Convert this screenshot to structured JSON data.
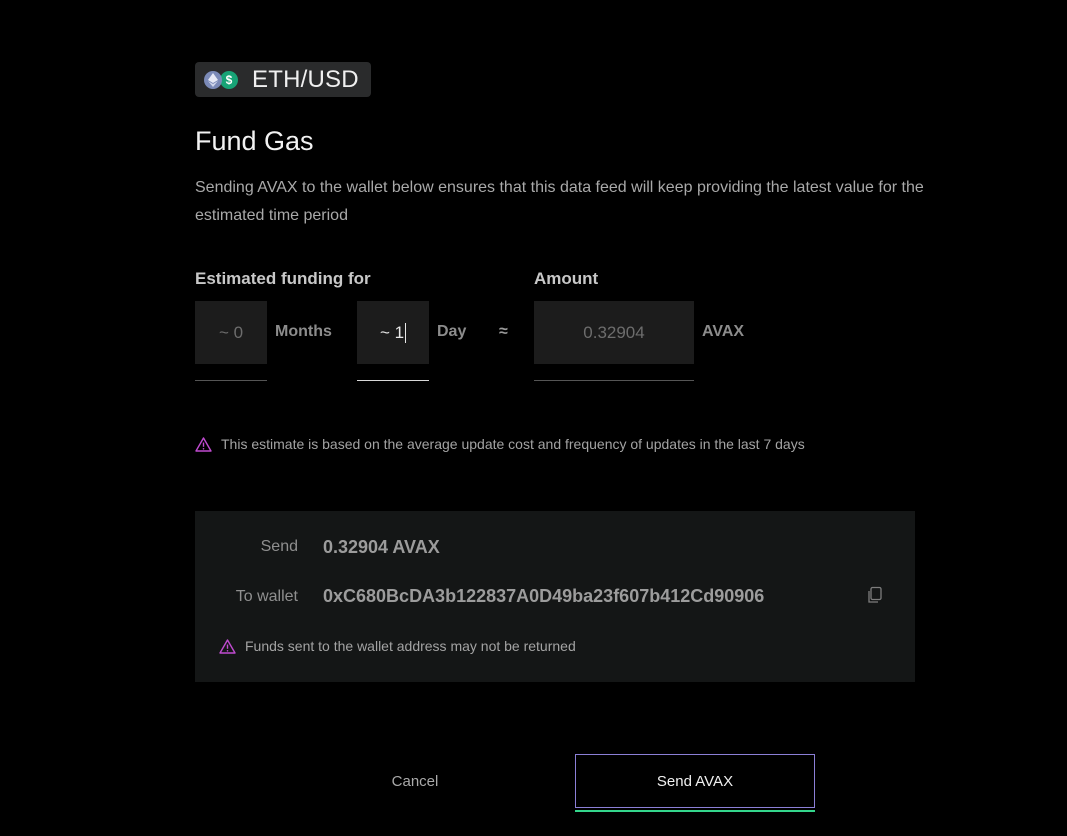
{
  "pair": {
    "label": "ETH/USD",
    "icons": [
      "eth-icon",
      "usd-icon"
    ]
  },
  "title": "Fund Gas",
  "description": "Sending AVAX to the wallet below ensures that this data feed will keep providing the latest value for the estimated time period",
  "funding": {
    "label": "Estimated funding for",
    "months_value": "~ 0",
    "months_unit": "Months",
    "days_value": "~ 1",
    "days_unit": "Day",
    "approx": "≈"
  },
  "amount": {
    "label": "Amount",
    "value": "0.32904",
    "unit": "AVAX"
  },
  "estimate_warning": "This estimate is based on the average update cost and frequency of updates in the last 7 days",
  "send_panel": {
    "send_label": "Send",
    "send_value": "0.32904 AVAX",
    "wallet_label": "To wallet",
    "wallet_address": "0xC680BcDA3b122837A0D49ba23f607b412Cd90906",
    "warning": "Funds sent to the wallet address may not be returned"
  },
  "buttons": {
    "cancel": "Cancel",
    "send": "Send AVAX"
  },
  "colors": {
    "warning_icon": "#c04bd0",
    "send_border": "#8b7fd6",
    "send_underline": "#34d68c"
  }
}
